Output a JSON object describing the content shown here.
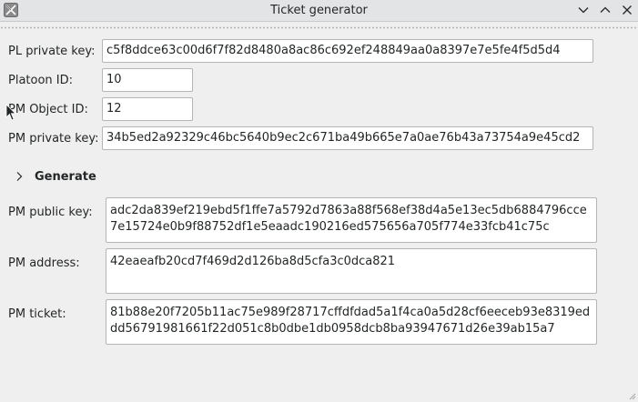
{
  "window": {
    "title": "Ticket generator"
  },
  "form": {
    "pl_private_key": {
      "label": "PL private key:",
      "value": "c5f8ddce63c00d6f7f82d8480a8ac86c692ef248849aa0a8397e7e5fe4f5d5d4"
    },
    "platoon_id": {
      "label": "Platoon ID:",
      "value": "10"
    },
    "pm_object_id": {
      "label": "PM Object ID:",
      "value": "12"
    },
    "pm_private_key": {
      "label": "PM private key:",
      "value": "34b5ed2a92329c46bc5640b9ec2c671ba49b665e7a0ae76b43a73754a9e45cd2"
    },
    "generate_label": "Generate"
  },
  "output": {
    "pm_public_key": {
      "label": "PM public key:",
      "value": "adc2da839ef219ebd5f1ffe7a5792d7863a88f568ef38d4a5e13ec5db6884796cce7e15724e0b9f88752df1e5eaadc190216ed575656a705f774e33fcb41c75c"
    },
    "pm_address": {
      "label": "PM address:",
      "value": "42eaeafb20cd7f469d2d126ba8d5cfa3c0dca821"
    },
    "pm_ticket": {
      "label": "PM ticket:",
      "value": "81b88e20f7205b11ac75e989f28717cffdfdad5a1f4ca0a5d28cf6eeceb93e8319eddd56791981661f22d051c8b0dbe1db0958dcb8ba93947671d26e39ab15a7"
    }
  },
  "icons": {
    "app": "app-icon",
    "minimize": "chevron-down-icon",
    "maximize": "chevron-up-icon",
    "close": "close-icon",
    "generate": "chevron-right-icon"
  }
}
